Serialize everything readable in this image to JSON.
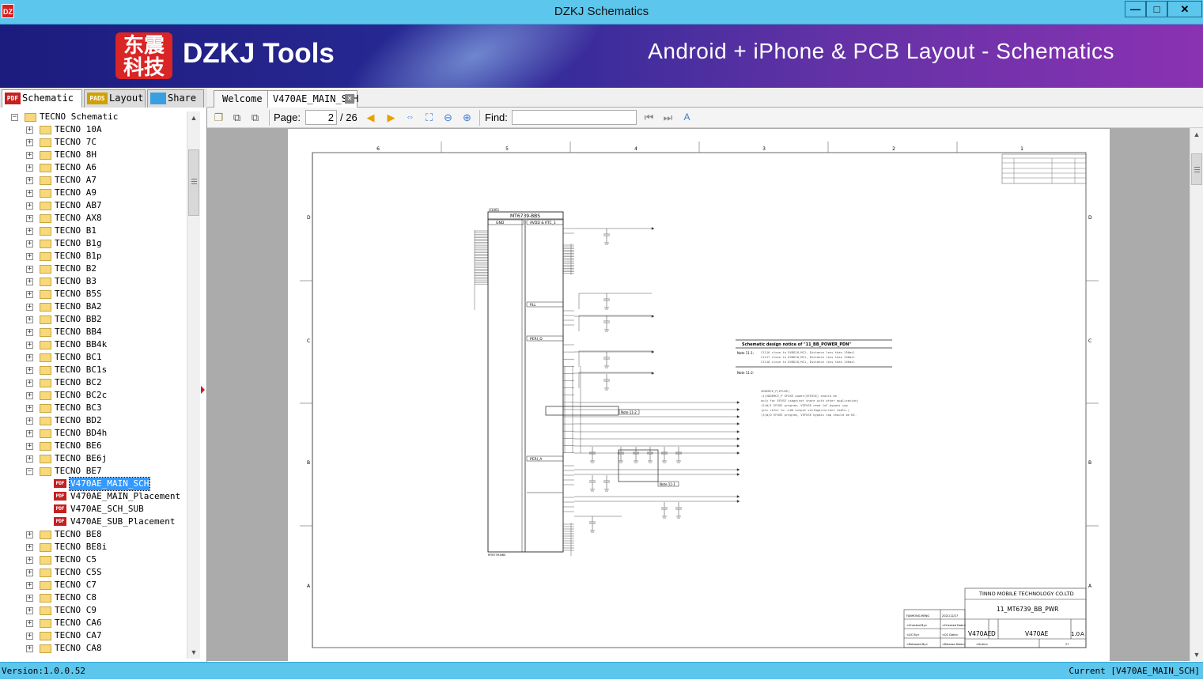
{
  "window": {
    "title": "DZKJ Schematics",
    "app_icon": "DZ",
    "minimize": "—",
    "maximize": "□",
    "close": "✕"
  },
  "banner": {
    "logo_chars": "东震科技",
    "logo_text": "DZKJ Tools",
    "tagline": "Android + iPhone & PCB Layout - Schematics"
  },
  "left_tabs": [
    {
      "label": "Schematic",
      "icon": "PDF"
    },
    {
      "label": "Layout",
      "icon": "PADS"
    },
    {
      "label": "Share",
      "icon": "share-icon"
    }
  ],
  "doc_tabs": [
    {
      "label": "Welcome"
    },
    {
      "label": "V470AE_MAIN_SCH"
    }
  ],
  "tree": {
    "root": "TECNO Schematic",
    "folders_before": [
      "TECNO 10A",
      "TECNO 7C",
      "TECNO 8H",
      "TECNO A6",
      "TECNO A7",
      "TECNO A9",
      "TECNO AB7",
      "TECNO AX8",
      "TECNO B1",
      "TECNO B1g",
      "TECNO B1p",
      "TECNO B2",
      "TECNO B3",
      "TECNO B5S",
      "TECNO BA2",
      "TECNO BB2",
      "TECNO BB4",
      "TECNO BB4k",
      "TECNO BC1",
      "TECNO BC1s",
      "TECNO BC2",
      "TECNO BC2c",
      "TECNO BC3",
      "TECNO BD2",
      "TECNO BD4h",
      "TECNO BE6",
      "TECNO BE6j"
    ],
    "expanded_folder": "TECNO BE7",
    "files": [
      "V470AE_MAIN_SCH",
      "V470AE_MAIN_Placement",
      "V470AE_SCH_SUB",
      "V470AE_SUB_Placement"
    ],
    "folders_after": [
      "TECNO BE8",
      "TECNO BE8i",
      "TECNO C5",
      "TECNO C5S",
      "TECNO C7",
      "TECNO C8",
      "TECNO C9",
      "TECNO CA6",
      "TECNO CA7",
      "TECNO CA8"
    ]
  },
  "toolbar": {
    "page_label": "Page:",
    "page_current": "2",
    "page_total": "/ 26",
    "find_label": "Find:",
    "find_value": ""
  },
  "schematic": {
    "cols": [
      "6",
      "5",
      "4",
      "3",
      "2",
      "1"
    ],
    "rows": [
      "D",
      "C",
      "B",
      "A"
    ],
    "chip_ref": "U1001",
    "chip_name": "MT6739-BBS",
    "sections": [
      "GND",
      "AVDD & RTC_1",
      "PLL",
      "PERI_D",
      "PERI_A"
    ],
    "design_notice_title": "Schematic design notice of \"11_BB_POWER_PDN\"",
    "note1_label": "Note 11-1:",
    "note1_lines": [
      "C1116 close to DVDD18_MC1, Distance less than 150mil",
      "C1117 close to DVDD18_MC1, Distance less than 150mil",
      "C1118 close to DVDD18_MC1, Distance less than 150mil"
    ],
    "note2_label": "Note 11-2:",
    "efuse_lines": [
      "VDDEMCE_P(EFUSE)",
      "(1)VDDEMCE_P EFUSE power(VEFUSE) should be",
      "only for EFUSE usage(not share with other application)",
      "(2)W/I EFUSE program, VEFUSE need 1uF bypass cap",
      "(pls refer to :LDO output voltage/current table.)",
      "(3)W/O EFUSE program, VEFUSE bypass cap should be NC."
    ],
    "company": "TINNO MOBILE TECHNOLOGY CO.LTD",
    "sheet_title": "11_MT6739_BB_PWR",
    "project": "V470AE",
    "size": "D",
    "revision": "1.0",
    "rev_letter": "A",
    "drawn_by": "FANHONG.MENG",
    "date": "2021/12/27",
    "checked": "<Checked By>",
    "checked_date": "<Checked Date>",
    "qc": "<QC By>",
    "qc_date": "<QC Date>",
    "released": "<Released By>",
    "released_date": "<Release Date>",
    "scale": "<Scale>",
    "sheet_no": "27",
    "note_tag_1": "Note 11-2",
    "note_tag_2": "Note 11-1",
    "chip_bottom_ref": "MT6739-BBS"
  },
  "status": {
    "version": "Version:1.0.0.52",
    "current": "Current [V470AE_MAIN_SCH]"
  }
}
